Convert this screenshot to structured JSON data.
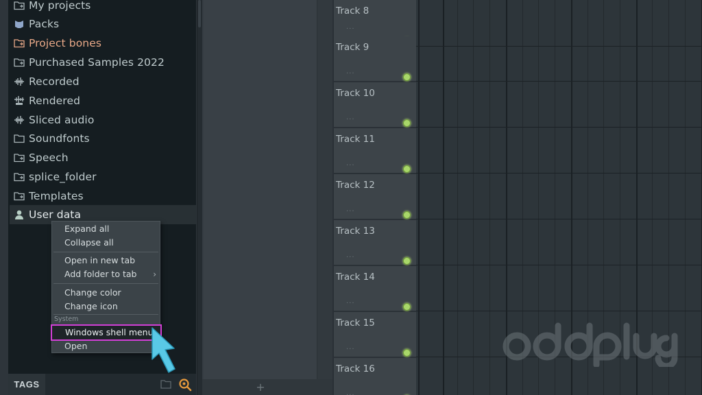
{
  "browser": {
    "items": [
      {
        "label": "My projects",
        "icon": "folder-tab-icon",
        "style": "normal"
      },
      {
        "label": "Packs",
        "icon": "packs-icon",
        "style": "normal"
      },
      {
        "label": "Project bones",
        "icon": "folder-tab-icon",
        "style": "orange"
      },
      {
        "label": "Purchased Samples 2022",
        "icon": "folder-tab-icon",
        "style": "normal"
      },
      {
        "label": "Recorded",
        "icon": "waveform-icon",
        "style": "normal"
      },
      {
        "label": "Rendered",
        "icon": "rendered-icon",
        "style": "normal"
      },
      {
        "label": "Sliced audio",
        "icon": "waveform-icon",
        "style": "normal"
      },
      {
        "label": "Soundfonts",
        "icon": "folder-icon",
        "style": "normal"
      },
      {
        "label": "Speech",
        "icon": "folder-tab-icon",
        "style": "normal"
      },
      {
        "label": "splice_folder",
        "icon": "folder-tab-icon",
        "style": "normal"
      },
      {
        "label": "Templates",
        "icon": "folder-tab-icon",
        "style": "normal"
      },
      {
        "label": "User data",
        "icon": "user-icon",
        "style": "selected"
      }
    ],
    "tags_label": "TAGS"
  },
  "context_menu": {
    "expand_all": "Expand all",
    "collapse_all": "Collapse all",
    "open_new_tab": "Open in new tab",
    "add_folder_to_tab": "Add folder to tab",
    "change_color": "Change color",
    "change_icon": "Change icon",
    "system_label": "System",
    "windows_shell_menu": "Windows shell menu",
    "open": "Open",
    "submenu_arrow": "›"
  },
  "tracks": [
    {
      "name": "Track 8"
    },
    {
      "name": "Track 9"
    },
    {
      "name": "Track 10"
    },
    {
      "name": "Track 11"
    },
    {
      "name": "Track 12"
    },
    {
      "name": "Track 13"
    },
    {
      "name": "Track 14"
    },
    {
      "name": "Track 15"
    },
    {
      "name": "Track 16"
    }
  ],
  "track_dots": "...",
  "add_track_label": "+",
  "watermark": "oddplug",
  "colors": {
    "led_green": "#a9d76a",
    "highlight_magenta": "#d23fd6",
    "arrow_cyan": "#59c9e6",
    "orange_label": "#e9a988"
  }
}
